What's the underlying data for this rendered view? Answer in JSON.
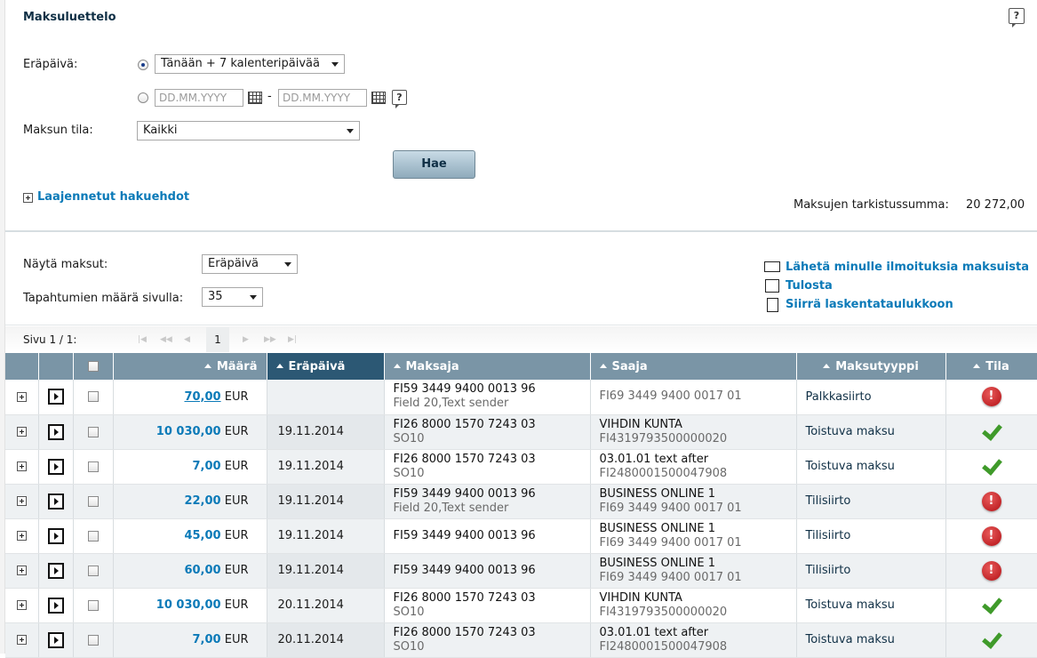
{
  "search": {
    "title": "Maksuluettelo",
    "duedate_label": "Eräpäivä:",
    "duedate_option": "Tänään + 7 kalenteripäivää",
    "date_from_placeholder": "DD.MM.YYYY",
    "date_to_placeholder": "DD.MM.YYYY",
    "date_separator": "-",
    "status_label": "Maksun tila:",
    "status_value": "Kaikki",
    "search_button": "Hae",
    "advanced_link": "Laajennetut hakuehdot",
    "checksum_label": "Maksujen tarkistussumma:",
    "checksum_value": "20 272,00"
  },
  "view": {
    "show_label": "Näytä maksut:",
    "show_value": "Eräpäivä",
    "perpage_label": "Tapahtumien määrä sivulla:",
    "perpage_value": "35"
  },
  "actions": {
    "notify": "Lähetä minulle ilmoituksia maksuista",
    "print": "Tulosta",
    "export": "Siirrä laskentataulukkoon"
  },
  "pager": {
    "label": "Sivu 1 / 1:",
    "current": "1"
  },
  "table": {
    "headers": {
      "amount": "Määrä",
      "duedate": "Eräpäivä",
      "payer": "Maksaja",
      "payee": "Saaja",
      "type": "Maksutyyppi",
      "status": "Tila"
    },
    "rows": [
      {
        "amount": "70,00",
        "currency": "EUR",
        "date": "",
        "payer1": "FI59 3449 9400 0013 96",
        "payer2": "Field 20,Text sender",
        "payee1": "FI69 3449 9400 0017 01",
        "payee2": "",
        "type": "Palkkasiirto",
        "status": "error",
        "status_glyph": "!"
      },
      {
        "amount": "10 030,00",
        "currency": "EUR",
        "date": "19.11.2014",
        "payer1": "FI26 8000 1570 7243 03",
        "payer2": "SO10",
        "payee1": "VIHDIN KUNTA",
        "payee2": "FI4319793500000020",
        "type": "Toistuva maksu",
        "status": "ok",
        "status_glyph": ""
      },
      {
        "amount": "7,00",
        "currency": "EUR",
        "date": "19.11.2014",
        "payer1": "FI26 8000 1570 7243 03",
        "payer2": "SO10",
        "payee1": "03.01.01 text after",
        "payee2": "FI2480001500047908",
        "type": "Toistuva maksu",
        "status": "ok",
        "status_glyph": ""
      },
      {
        "amount": "22,00",
        "currency": "EUR",
        "date": "19.11.2014",
        "payer1": "FI59 3449 9400 0013 96",
        "payer2": "Field 20,Text sender",
        "payee1": "BUSINESS ONLINE 1",
        "payee2": "FI69 3449 9400 0017 01",
        "type": "Tilisiirto",
        "status": "error",
        "status_glyph": "!"
      },
      {
        "amount": "45,00",
        "currency": "EUR",
        "date": "19.11.2014",
        "payer1": "FI59 3449 9400 0013 96",
        "payer2": "",
        "payee1": "BUSINESS ONLINE 1",
        "payee2": "FI69 3449 9400 0017 01",
        "type": "Tilisiirto",
        "status": "error",
        "status_glyph": "!"
      },
      {
        "amount": "60,00",
        "currency": "EUR",
        "date": "19.11.2014",
        "payer1": "FI59 3449 9400 0013 96",
        "payer2": "",
        "payee1": "BUSINESS ONLINE 1",
        "payee2": "FI69 3449 9400 0017 01",
        "type": "Tilisiirto",
        "status": "error",
        "status_glyph": "!"
      },
      {
        "amount": "10 030,00",
        "currency": "EUR",
        "date": "20.11.2014",
        "payer1": "FI26 8000 1570 7243 03",
        "payer2": "SO10",
        "payee1": "VIHDIN KUNTA",
        "payee2": "FI4319793500000020",
        "type": "Toistuva maksu",
        "status": "ok",
        "status_glyph": ""
      },
      {
        "amount": "7,00",
        "currency": "EUR",
        "date": "20.11.2014",
        "payer1": "FI26 8000 1570 7243 03",
        "payer2": "SO10",
        "payee1": "03.01.01 text after",
        "payee2": "FI2480001500047908",
        "type": "Toistuva maksu",
        "status": "ok",
        "status_glyph": ""
      }
    ]
  },
  "colors": {
    "link": "#0b7ab8",
    "header": "#7a95a6",
    "header_sorted": "#2c5874",
    "error": "#c0151b",
    "ok": "#3f9a2a"
  }
}
